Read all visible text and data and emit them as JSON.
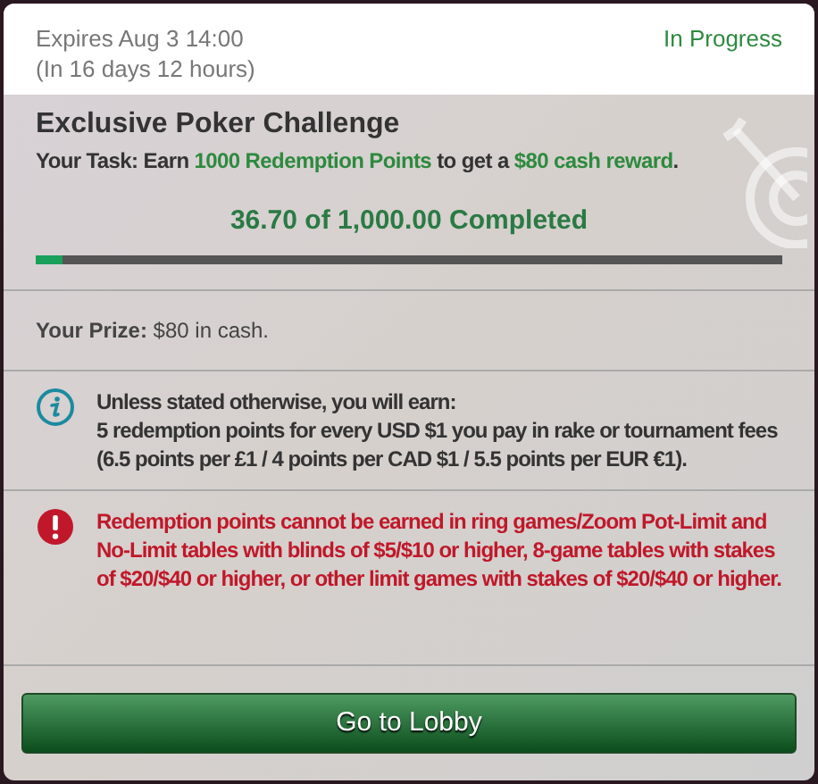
{
  "header": {
    "expires": "Expires Aug 3 14:00",
    "remaining": "(In 16 days 12 hours)",
    "status": "In Progress"
  },
  "challenge": {
    "title": "Exclusive Poker Challenge",
    "task": [
      {
        "text": "Your Task: Earn ",
        "highlight": false
      },
      {
        "text": "1000 Redemption Points",
        "highlight": true
      },
      {
        "text": " to get a ",
        "highlight": false
      },
      {
        "text": "$80 cash reward",
        "highlight": true
      },
      {
        "text": ".",
        "highlight": false
      }
    ],
    "progress_text": "36.70 of 1,000.00 Completed",
    "level": 0.0367
  },
  "prize": "**Your Prize:** $80 in cash.",
  "notices": [
    {
      "kind": "info",
      "heading": "Unless stated otherwise, you will earn:",
      "text": "5 redemption points for every USD $1 you pay in rake or tournament fees (6.5 points per £1 / 4 points per CAD $1 / 5.5 points per EUR €1)."
    },
    {
      "kind": "warning",
      "text": "Redemption points cannot be earned in ring games/Zoom Pot-Limit and No-Limit tables with blinds of $5/$10 or higher, 8-game tables with stakes of $20/$40 or higher, or other limit games with stakes of $20/$40 or higher."
    }
  ],
  "button": "Go to Lobby"
}
